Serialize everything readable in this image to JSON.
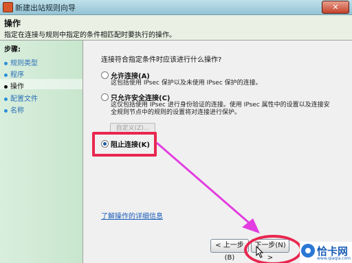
{
  "window": {
    "title": "新建出站规则向导",
    "close_label": "✕"
  },
  "header": {
    "title": "操作",
    "description": "指定在连接与规则中指定的条件相匹配时要执行的操作。"
  },
  "sidebar": {
    "heading": "步骤:",
    "items": [
      {
        "label": "规则类型"
      },
      {
        "label": "程序"
      },
      {
        "label": "操作"
      },
      {
        "label": "配置文件"
      },
      {
        "label": "名称"
      }
    ]
  },
  "main": {
    "question": "连接符合指定条件时应该进行什么操作?",
    "options": [
      {
        "label": "允许连接(A)",
        "description": "这包括使用 IPsec 保护以及未使用 IPsec 保护的连接。",
        "selected": false
      },
      {
        "label": "只允许安全连接(C)",
        "description_line1": "这仅包括使用 IPsec 进行身份验证的连接。使用 IPsec 属性中的设置以及连接安",
        "description_line2": "全规则节点中的规则的设置将对连接进行保护。",
        "selected": false
      },
      {
        "label": "阻止连接(K)",
        "selected": true
      }
    ],
    "custom_button": "自定义(Z)...",
    "link": "了解操作的详细信息"
  },
  "footer": {
    "back_label": "< 上一步(B)",
    "next_label": "下一步(N) >"
  },
  "watermark": {
    "text": "恰卡网",
    "sub": "www.qiaqia.com"
  },
  "colors": {
    "highlight": "#e8274f",
    "arrow": "#e23de0",
    "sidebar": "#d9eedd"
  }
}
